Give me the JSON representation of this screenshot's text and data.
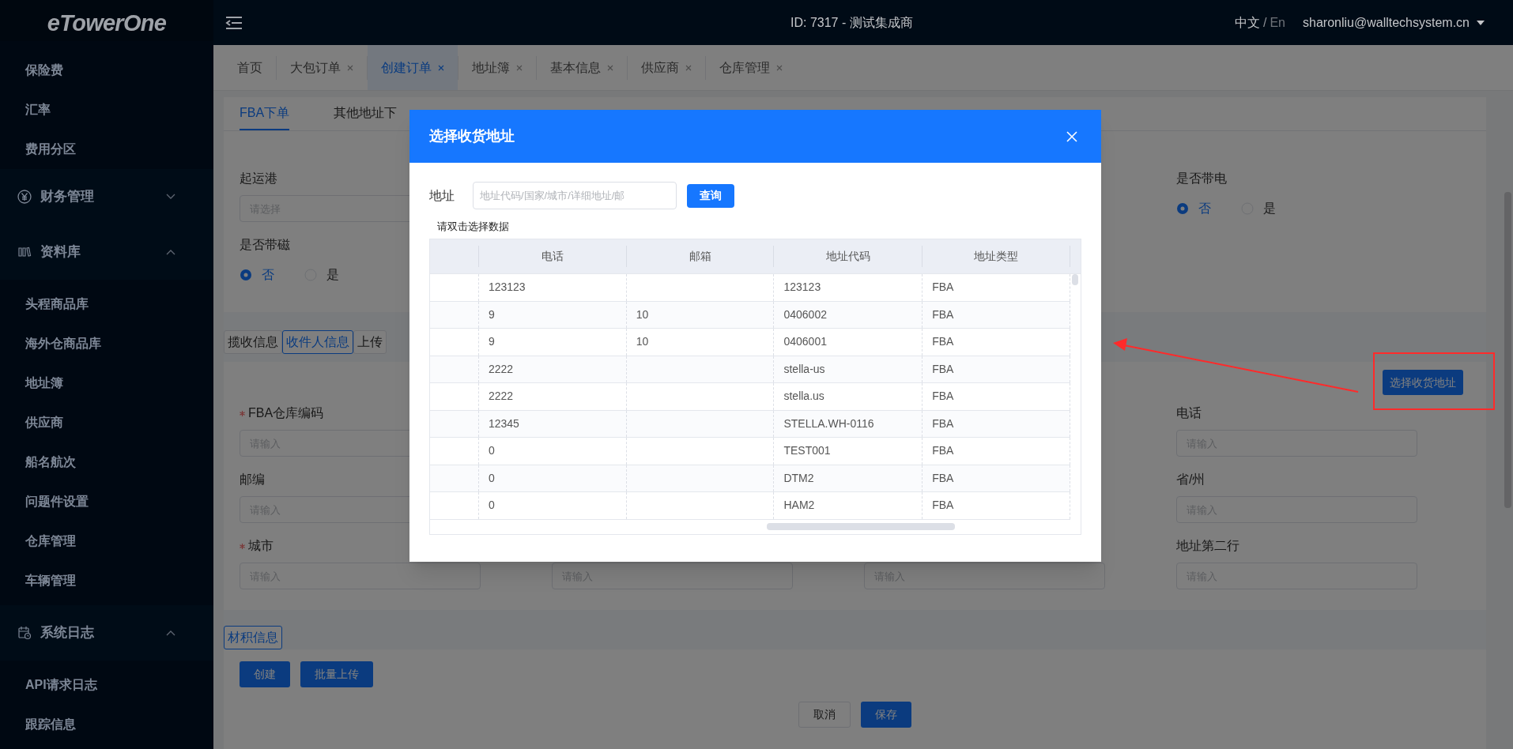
{
  "logo": "eTowerOne",
  "sidebar": {
    "items": [
      {
        "kind": "item",
        "label": "保险费"
      },
      {
        "kind": "item",
        "label": "汇率"
      },
      {
        "kind": "item",
        "label": "费用分区"
      },
      {
        "kind": "group",
        "label": "财务管理",
        "expanded": false
      },
      {
        "kind": "group",
        "label": "资料库",
        "expanded": true,
        "children": [
          {
            "label": "头程商品库"
          },
          {
            "label": "海外仓商品库"
          },
          {
            "label": "地址簿"
          },
          {
            "label": "供应商"
          },
          {
            "label": "船名航次"
          },
          {
            "label": "问题件设置"
          },
          {
            "label": "仓库管理"
          },
          {
            "label": "车辆管理"
          }
        ]
      },
      {
        "kind": "group",
        "label": "系统日志",
        "expanded": true,
        "children": [
          {
            "label": "API请求日志"
          },
          {
            "label": "跟踪信息"
          }
        ]
      }
    ]
  },
  "header": {
    "title": "ID: 7317 - 测试集成商",
    "languages": [
      {
        "label": "中文",
        "selected": true
      },
      {
        "label": "En",
        "selected": false
      }
    ],
    "separator": "/",
    "user": "sharonliu@walltechsystem.cn"
  },
  "tabs": [
    {
      "label": "首页",
      "closable": false,
      "selected": false
    },
    {
      "label": "大包订单",
      "closable": true,
      "selected": false
    },
    {
      "label": "创建订单",
      "closable": true,
      "selected": true
    },
    {
      "label": "地址簿",
      "closable": true,
      "selected": false
    },
    {
      "label": "基本信息",
      "closable": true,
      "selected": false
    },
    {
      "label": "供应商",
      "closable": true,
      "selected": false
    },
    {
      "label": "仓库管理",
      "closable": true,
      "selected": false
    }
  ],
  "sub_tabs": [
    {
      "label": "FBA下单",
      "selected": true
    },
    {
      "label": "其他地址下",
      "selected": false
    }
  ],
  "order_form": {
    "rows": [
      [
        {
          "kind": "select",
          "label": "起运港",
          "placeholder": "请选择"
        },
        null,
        null,
        {
          "kind": "radio",
          "label": "是否带电",
          "options": [
            {
              "label": "否",
              "selected": true
            },
            {
              "label": "是",
              "selected": false
            }
          ]
        }
      ],
      [
        {
          "kind": "radio",
          "label": "是否带磁",
          "options": [
            {
              "label": "否",
              "selected": true
            },
            {
              "label": "是",
              "selected": false
            }
          ]
        },
        null,
        null,
        null
      ]
    ]
  },
  "section_tabs": [
    {
      "label": "揽收信息",
      "selected": false
    },
    {
      "label": "收件人信息",
      "selected": true
    },
    {
      "label": "上传",
      "selected": false
    }
  ],
  "select_address_button": {
    "label": "选择收货地址",
    "highlighted": true
  },
  "recipient_form": {
    "rows": [
      [
        {
          "kind": "input",
          "label": "FBA仓库编码",
          "required": true,
          "placeholder": "请输入"
        },
        null,
        null,
        {
          "kind": "input",
          "label": "电话",
          "placeholder": "请输入"
        }
      ],
      [
        {
          "kind": "input",
          "label": "邮编",
          "placeholder": "请输入"
        },
        null,
        null,
        {
          "kind": "input",
          "label": "省/州",
          "placeholder": "请输入"
        }
      ],
      [
        {
          "kind": "input",
          "label": "城市",
          "required": true,
          "placeholder": "请输入"
        },
        {
          "kind": "input",
          "placeholder": "请输入"
        },
        {
          "kind": "input",
          "placeholder": "请输入"
        },
        {
          "kind": "input",
          "label": "地址第二行",
          "placeholder": "请输入"
        }
      ]
    ]
  },
  "volume_tabs": [
    {
      "label": "材积信息",
      "selected": true
    }
  ],
  "volume_buttons": [
    "创建",
    "批量上传"
  ],
  "footer_buttons": [
    {
      "label": "取消",
      "kind": "default"
    },
    {
      "label": "保存",
      "kind": "primary"
    }
  ],
  "dialog": {
    "title": "选择收货地址",
    "search": {
      "label": "地址",
      "placeholder": "地址代码/国家/城市/详细地址/邮",
      "button": "查询"
    },
    "hint": "请双击选择数据",
    "table": {
      "columns": [
        "电话",
        "邮箱",
        "地址代码",
        "地址类型"
      ],
      "rows": [
        {
          "phone": "123123",
          "address_code": "123123",
          "address_type": "FBA"
        },
        {
          "phone": "9",
          "email": "10",
          "address_code": "0406002",
          "address_type": "FBA"
        },
        {
          "phone": "9",
          "email": "10",
          "address_code": "0406001",
          "address_type": "FBA"
        },
        {
          "phone": "2222",
          "address_code": "stella-us",
          "address_type": "FBA"
        },
        {
          "phone": "2222",
          "address_code": "stella.us",
          "address_type": "FBA"
        },
        {
          "phone": "12345",
          "address_code": "STELLA.WH-0116",
          "address_type": "FBA"
        },
        {
          "phone": "0",
          "address_code": "TEST001",
          "address_type": "FBA"
        },
        {
          "phone": "0",
          "address_code": "DTM2",
          "address_type": "FBA"
        },
        {
          "phone": "0",
          "address_code": "HAM2",
          "address_type": "FBA"
        }
      ]
    }
  }
}
